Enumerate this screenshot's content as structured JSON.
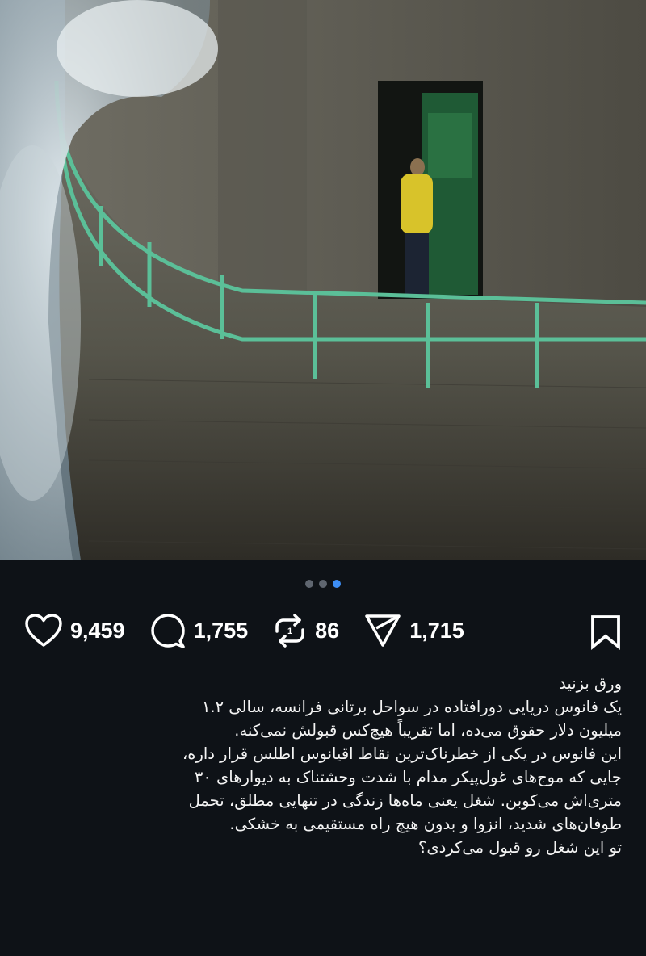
{
  "carousel": {
    "total": 3,
    "active_index": 2
  },
  "actions": {
    "likes": "9,459",
    "comments": "1,755",
    "reposts": "86",
    "shares": "1,715"
  },
  "caption": {
    "lines": [
      "ورق بزنید",
      "یک فانوس دریایی دورافتاده در سواحل برتانی فرانسه، سالی ۱.۲",
      "میلیون دلار حقوق می‌ده، اما تقریباً هیچ‌کس قبولش نمی‌کنه.",
      "این فانوس در یکی از خطرناک‌ترین نقاط اقیانوس اطلس قرار داره،",
      "جایی که موج‌های غول‌پیکر مدام با شدت وحشتناک به دیوارهای ۳۰",
      "متری‌اش می‌کوبن. شغل یعنی ماه‌ها زندگی در تنهایی مطلق، تحمل",
      "طوفان‌های شدید، انزوا و بدون هیچ راه مستقیمی به خشکی.",
      "تو این شغل رو قبول می‌کردی؟"
    ]
  },
  "icons": {
    "like": "heart-icon",
    "comment": "comment-bubble-icon",
    "repost": "repost-arrows-icon",
    "share": "paper-plane-icon",
    "save": "bookmark-icon"
  },
  "colors": {
    "background": "#0e1217",
    "dot_active": "#3d8ef5",
    "dot_inactive": "#5f6670",
    "text": "#ffffff"
  }
}
